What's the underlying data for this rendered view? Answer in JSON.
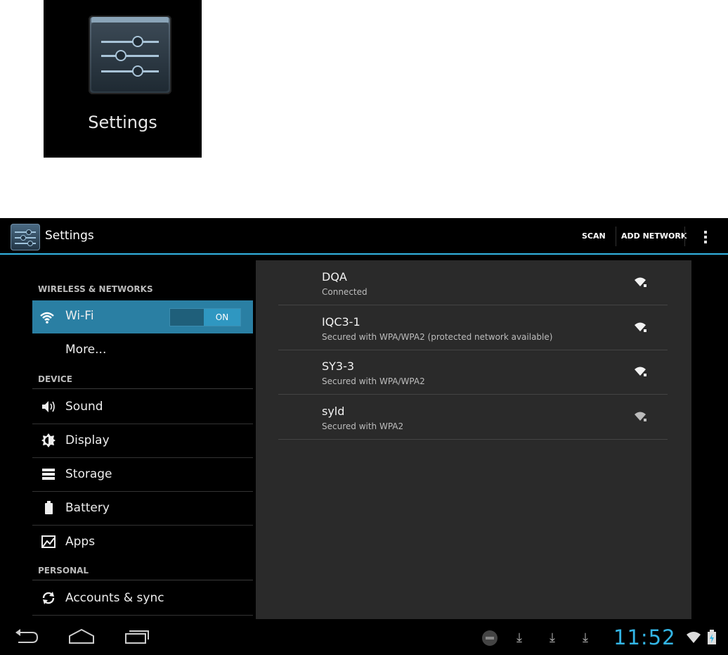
{
  "launcher": {
    "caption": "Settings",
    "icon": "settings-sliders-icon"
  },
  "actionbar": {
    "title": "Settings",
    "scan_label": "SCAN",
    "add_network_label": "ADD NETWORK",
    "overflow_icon": "overflow-menu-icon",
    "accent": "#33b5e5"
  },
  "menu": {
    "categories": {
      "wireless": "WIRELESS & NETWORKS",
      "device": "DEVICE",
      "personal": "PERSONAL"
    },
    "wifi": {
      "label": "Wi-Fi",
      "toggle": "ON",
      "icon": "wifi-icon"
    },
    "more": {
      "label": "More..."
    },
    "sound": {
      "label": "Sound",
      "icon": "speaker-icon"
    },
    "display": {
      "label": "Display",
      "icon": "brightness-icon"
    },
    "storage": {
      "label": "Storage",
      "icon": "storage-icon"
    },
    "battery": {
      "label": "Battery",
      "icon": "battery-icon"
    },
    "apps": {
      "label": "Apps",
      "icon": "apps-icon"
    },
    "accounts": {
      "label": "Accounts & sync",
      "icon": "sync-icon"
    }
  },
  "networks": [
    {
      "ssid": "DQA",
      "status": "Connected"
    },
    {
      "ssid": "IQC3-1",
      "status": "Secured with WPA/WPA2 (protected network available)"
    },
    {
      "ssid": "SY3-3",
      "status": "Secured with WPA/WPA2"
    },
    {
      "ssid": "syld",
      "status": "Secured with WPA2"
    }
  ],
  "statusbar": {
    "time": "11:52"
  }
}
